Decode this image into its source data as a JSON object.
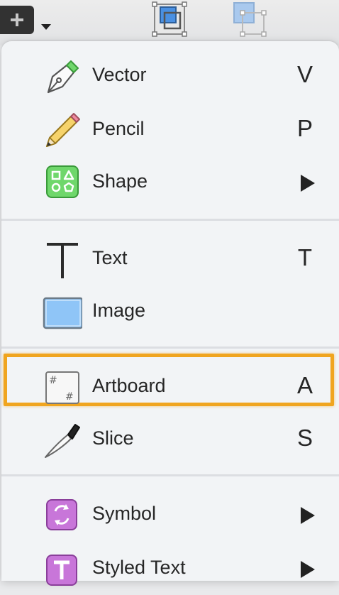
{
  "toolbar": {
    "insert_icon": "plus-icon",
    "dropdown_icon": "chevron-down-icon",
    "group_icon": "group-icon",
    "ungroup_icon": "ungroup-icon"
  },
  "menu": {
    "items": [
      {
        "label": "Vector",
        "shortcut": "V",
        "icon": "pen-icon"
      },
      {
        "label": "Pencil",
        "shortcut": "P",
        "icon": "pencil-icon"
      },
      {
        "label": "Shape",
        "shortcut": "",
        "icon": "shape-icon",
        "submenu": true
      },
      {
        "label": "Text",
        "shortcut": "T",
        "icon": "text-icon"
      },
      {
        "label": "Image",
        "shortcut": "",
        "icon": "image-icon"
      },
      {
        "label": "Artboard",
        "shortcut": "A",
        "icon": "artboard-icon",
        "highlighted": true
      },
      {
        "label": "Slice",
        "shortcut": "S",
        "icon": "knife-icon"
      },
      {
        "label": "Symbol",
        "shortcut": "",
        "icon": "symbol-icon",
        "submenu": true
      },
      {
        "label": "Styled Text",
        "shortcut": "",
        "icon": "styled-text-icon",
        "submenu": true
      }
    ]
  },
  "colors": {
    "highlight": "#f0a51f",
    "shape_icon": "#6fd76b",
    "image_icon": "#8fc5f7",
    "symbol_icon": "#c876d9"
  }
}
